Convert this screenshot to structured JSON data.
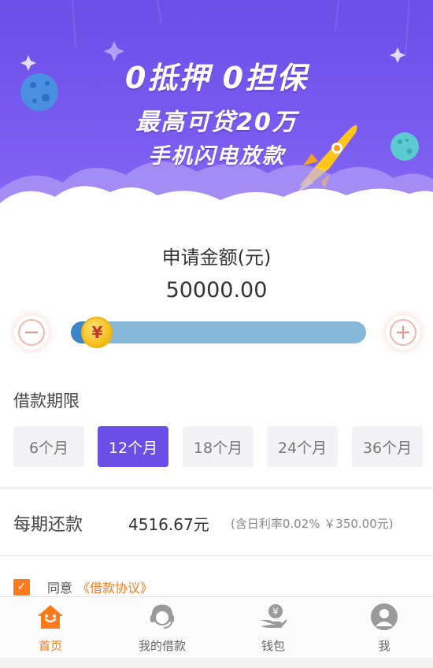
{
  "banner": {
    "line1": "0抵押  0担保",
    "line2": "最高可贷20万",
    "line3": "手机闪电放款"
  },
  "amount": {
    "title": "申请金额(元)",
    "value": "50000.00",
    "minus_symbol": "−",
    "plus_symbol": "+",
    "thumb_symbol": "¥",
    "slider_fraction": 0.02
  },
  "term": {
    "label": "借款期限",
    "options": [
      "6个月",
      "12个月",
      "18个月",
      "24个月",
      "36个月"
    ],
    "selected_index": 1
  },
  "repayment": {
    "label": "每期还款",
    "amount": "4516.67元",
    "note": "(含日利率0.02% ￥350.00元)"
  },
  "agreement": {
    "checked": true,
    "check_symbol": "✓",
    "text": "同意",
    "link": "《借款协议》"
  },
  "nav": {
    "items": [
      {
        "label": "首页",
        "icon": "home-icon",
        "active": true
      },
      {
        "label": "我的借款",
        "icon": "customer-service-icon",
        "active": false
      },
      {
        "label": "钱包",
        "icon": "wallet-icon",
        "active": false
      },
      {
        "label": "我",
        "icon": "user-icon",
        "active": false
      }
    ]
  },
  "colors": {
    "accent": "#6b4ee6",
    "orange": "#ff7a1a",
    "slider_track": "#88b8d9",
    "slider_fill": "#3c86c7"
  }
}
